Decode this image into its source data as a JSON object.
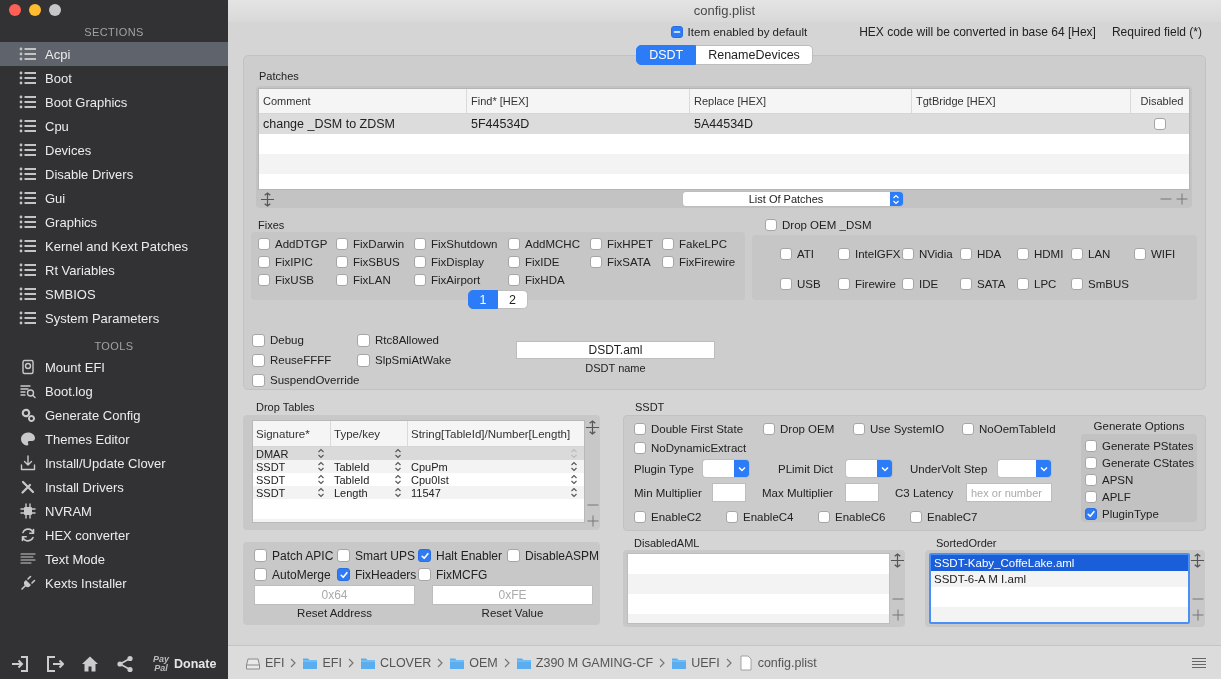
{
  "window": {
    "title": "config.plist"
  },
  "sidebar": {
    "sections_title": "SECTIONS",
    "sections": [
      {
        "label": "Acpi",
        "selected": true
      },
      {
        "label": "Boot",
        "selected": false
      },
      {
        "label": "Boot Graphics",
        "selected": false
      },
      {
        "label": "Cpu",
        "selected": false
      },
      {
        "label": "Devices",
        "selected": false
      },
      {
        "label": "Disable Drivers",
        "selected": false
      },
      {
        "label": "Gui",
        "selected": false
      },
      {
        "label": "Graphics",
        "selected": false
      },
      {
        "label": "Kernel and Kext Patches",
        "selected": false
      },
      {
        "label": "Rt Variables",
        "selected": false
      },
      {
        "label": "SMBIOS",
        "selected": false
      },
      {
        "label": "System Parameters",
        "selected": false
      }
    ],
    "tools_title": "TOOLS",
    "tools": [
      {
        "label": "Mount EFI",
        "kind": "disk"
      },
      {
        "label": "Boot.log",
        "kind": "log"
      },
      {
        "label": "Generate Config",
        "kind": "gears"
      },
      {
        "label": "Themes Editor",
        "kind": "palette"
      },
      {
        "label": "Install/Update Clover",
        "kind": "download"
      },
      {
        "label": "Install Drivers",
        "kind": "tools"
      },
      {
        "label": "NVRAM",
        "kind": "chip"
      },
      {
        "label": "HEX converter",
        "kind": "refresh"
      },
      {
        "label": "Text Mode",
        "kind": "text"
      },
      {
        "label": "Kexts Installer",
        "kind": "plug"
      }
    ],
    "donate": {
      "logo": [
        "Pay",
        "Pal"
      ],
      "label": "Donate"
    }
  },
  "header": {
    "default_item": {
      "label": "Item enabled by default",
      "checked": true,
      "mixed": true
    },
    "hex_note": "HEX code will be converted in base 64 [Hex]",
    "required_note": "Required field (*)"
  },
  "tabs": [
    {
      "label": "DSDT",
      "selected": true
    },
    {
      "label": "RenameDevices",
      "selected": false
    }
  ],
  "patches": {
    "title": "Patches",
    "columns": [
      "Comment",
      "Find* [HEX]",
      "Replace [HEX]",
      "TgtBridge [HEX]",
      "Disabled"
    ],
    "rows": [
      {
        "comment": "change _DSM to ZDSM",
        "find": "5F44534D",
        "replace": "5A44534D",
        "disabled": false,
        "selected": true
      }
    ],
    "popup": "List Of Patches"
  },
  "fixes": {
    "title": "Fixes",
    "items": [
      {
        "label": "AddDTGP",
        "checked": false
      },
      {
        "label": "FixDarwin",
        "checked": false
      },
      {
        "label": "FixShutdown",
        "checked": false
      },
      {
        "label": "AddMCHC",
        "checked": false
      },
      {
        "label": "FixHPET",
        "checked": false
      },
      {
        "label": "FakeLPC",
        "checked": false
      },
      {
        "label": "FixIPIC",
        "checked": false
      },
      {
        "label": "FixSBUS",
        "checked": false
      },
      {
        "label": "FixDisplay",
        "checked": false
      },
      {
        "label": "FixIDE",
        "checked": false
      },
      {
        "label": "FixSATA",
        "checked": false
      },
      {
        "label": "FixFirewire",
        "checked": false
      },
      {
        "label": "FixUSB",
        "checked": false
      },
      {
        "label": "FixLAN",
        "checked": false
      },
      {
        "label": "FixAirport",
        "checked": false
      },
      {
        "label": "FixHDA",
        "checked": false
      }
    ],
    "pages": [
      {
        "label": "1",
        "selected": true
      },
      {
        "label": "2",
        "selected": false
      }
    ]
  },
  "drop_oem": {
    "label": "Drop OEM _DSM",
    "checked": false,
    "items": [
      {
        "label": "ATI",
        "checked": false
      },
      {
        "label": "IntelGFX",
        "checked": false
      },
      {
        "label": "NVidia",
        "checked": false
      },
      {
        "label": "HDA",
        "checked": false
      },
      {
        "label": "HDMI",
        "checked": false
      },
      {
        "label": "LAN",
        "checked": false
      },
      {
        "label": "WIFI",
        "checked": false
      },
      {
        "label": "USB",
        "checked": false
      },
      {
        "label": "Firewire",
        "checked": false
      },
      {
        "label": "IDE",
        "checked": false
      },
      {
        "label": "SATA",
        "checked": false
      },
      {
        "label": "LPC",
        "checked": false
      },
      {
        "label": "SmBUS",
        "checked": false
      }
    ]
  },
  "flags": [
    {
      "label": "Debug",
      "checked": false
    },
    {
      "label": "Rtc8Allowed",
      "checked": false
    },
    {
      "label": "ReuseFFFF",
      "checked": false
    },
    {
      "label": "SlpSmiAtWake",
      "checked": false
    },
    {
      "label": "SuspendOverride",
      "checked": false
    }
  ],
  "dsdt_name": {
    "value": "DSDT.aml",
    "label": "DSDT name"
  },
  "drop_tables": {
    "title": "Drop Tables",
    "columns": [
      "Signature*",
      "Type/key",
      "String[TableId]/Number[Length]"
    ],
    "rows": [
      {
        "signature": "DMAR",
        "selected": true
      },
      {
        "signature": "SSDT",
        "type_key": "TableId",
        "value": "CpuPm",
        "selected": false
      },
      {
        "signature": "SSDT",
        "type_key": "TableId",
        "value": "Cpu0Ist",
        "selected": false
      },
      {
        "signature": "SSDT",
        "type_key": "Length",
        "value": "11547",
        "selected": false
      }
    ]
  },
  "acpi_options": {
    "items": [
      {
        "label": "Patch APIC",
        "checked": false
      },
      {
        "label": "Smart UPS",
        "checked": false
      },
      {
        "label": "Halt Enabler",
        "checked": true
      },
      {
        "label": "DisableASPM",
        "checked": false
      },
      {
        "label": "AutoMerge",
        "checked": false
      },
      {
        "label": "FixHeaders",
        "checked": true
      },
      {
        "label": "FixMCFG",
        "checked": false
      }
    ],
    "reset_address": {
      "placeholder": "0x64",
      "label": "Reset Address"
    },
    "reset_value": {
      "placeholder": "0xFE",
      "label": "Reset Value"
    }
  },
  "ssdt": {
    "title": "SSDT",
    "checks": [
      {
        "label": "Double First State",
        "checked": false
      },
      {
        "label": "Drop OEM",
        "checked": false
      },
      {
        "label": "Use SystemIO",
        "checked": false
      },
      {
        "label": "NoOemTableId",
        "checked": false
      },
      {
        "label": "NoDynamicExtract",
        "checked": false
      }
    ],
    "plugin_type": "Plugin Type",
    "plimit_dict": "PLimit Dict",
    "undervolt_step": "UnderVolt Step",
    "min_multiplier": "Min Multiplier",
    "max_multiplier": "Max Multiplier",
    "c3_latency": {
      "label": "C3 Latency",
      "placeholder": "hex or number"
    },
    "enable": [
      {
        "label": "EnableC2",
        "checked": false
      },
      {
        "label": "EnableC4",
        "checked": false
      },
      {
        "label": "EnableC6",
        "checked": false
      },
      {
        "label": "EnableC7",
        "checked": false
      }
    ],
    "generate_options": {
      "title": "Generate Options",
      "items": [
        {
          "label": "Generate PStates",
          "checked": false
        },
        {
          "label": "Generate CStates",
          "checked": false
        },
        {
          "label": "APSN",
          "checked": false
        },
        {
          "label": "APLF",
          "checked": false
        },
        {
          "label": "PluginType",
          "checked": true
        }
      ]
    }
  },
  "disabled_aml": {
    "title": "DisabledAML"
  },
  "sorted_order": {
    "title": "SortedOrder",
    "items": [
      {
        "label": "SSDT-Kaby_CoffeLake.aml",
        "selected": true
      },
      {
        "label": "SSDT-6-A M I.aml",
        "selected": false
      }
    ]
  },
  "path": [
    {
      "label": "EFI",
      "kind": "disk"
    },
    {
      "label": "EFI",
      "kind": "folder"
    },
    {
      "label": "CLOVER",
      "kind": "folder"
    },
    {
      "label": "OEM",
      "kind": "folder"
    },
    {
      "label": "Z390 M GAMING-CF",
      "kind": "folder"
    },
    {
      "label": "UEFI",
      "kind": "folder"
    },
    {
      "label": "config.plist",
      "kind": "file"
    }
  ]
}
